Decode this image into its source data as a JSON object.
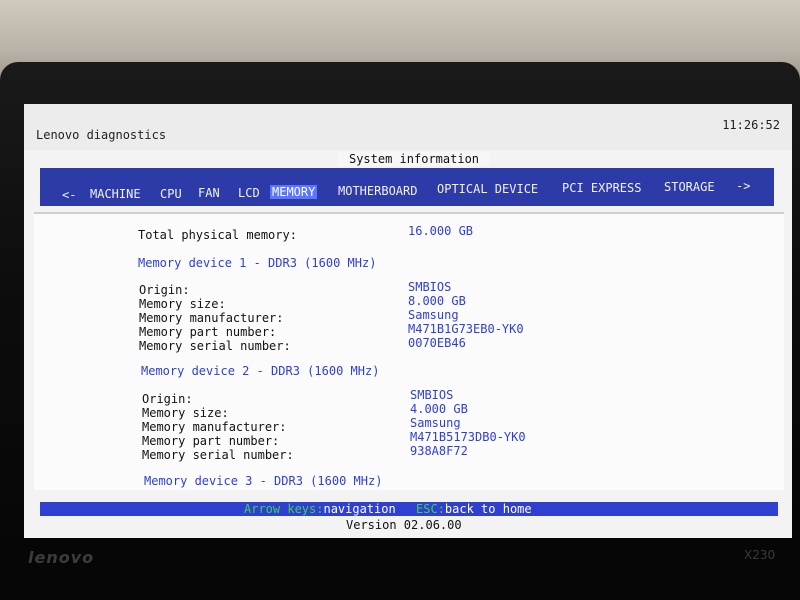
{
  "header": {
    "app_title": "Lenovo diagnostics",
    "time": "11:26:52"
  },
  "section_title": "System information",
  "nav": {
    "prev": "<-",
    "next": "->",
    "items": [
      "MACHINE",
      "CPU",
      "FAN",
      "LCD",
      "MEMORY",
      "MOTHERBOARD",
      "OPTICAL DEVICE",
      "PCI EXPRESS",
      "STORAGE"
    ],
    "active": "MEMORY"
  },
  "memory": {
    "total_label": "Total physical memory:",
    "total_value": "16.000 GB",
    "field_labels": {
      "origin": "Origin:",
      "size": "Memory size:",
      "manufacturer": "Memory manufacturer:",
      "part_number": "Memory part number:",
      "serial_number": "Memory serial number:"
    },
    "devices": [
      {
        "title": "Memory device 1 - DDR3 (1600 MHz)",
        "origin": "SMBIOS",
        "size": "8.000 GB",
        "manufacturer": "Samsung",
        "part_number": "M471B1G73EB0-YK0",
        "serial_number": "0070EB46"
      },
      {
        "title": "Memory device 2 - DDR3 (1600 MHz)",
        "origin": "SMBIOS",
        "size": "4.000 GB",
        "manufacturer": "Samsung",
        "part_number": "M471B5173DB0-YK0",
        "serial_number": "938A8F72"
      },
      {
        "title": "Memory device 3 - DDR3 (1600 MHz)"
      }
    ]
  },
  "status": {
    "arrow_keys": "Arrow keys",
    "arrow_sep": ":",
    "navigation": "navigation",
    "esc": "ESC",
    "esc_sep": ":",
    "back_home": "back to home"
  },
  "version": "Version 02.06.00",
  "bezel": {
    "brand": "lenovo",
    "model": "X230"
  },
  "colors": {
    "nav_bg": "#2d3ba8",
    "nav_active": "#5a76ff",
    "value_text": "#2e3fd6",
    "status_bg": "#2f3fd0",
    "key_text": "#3fd24a"
  }
}
